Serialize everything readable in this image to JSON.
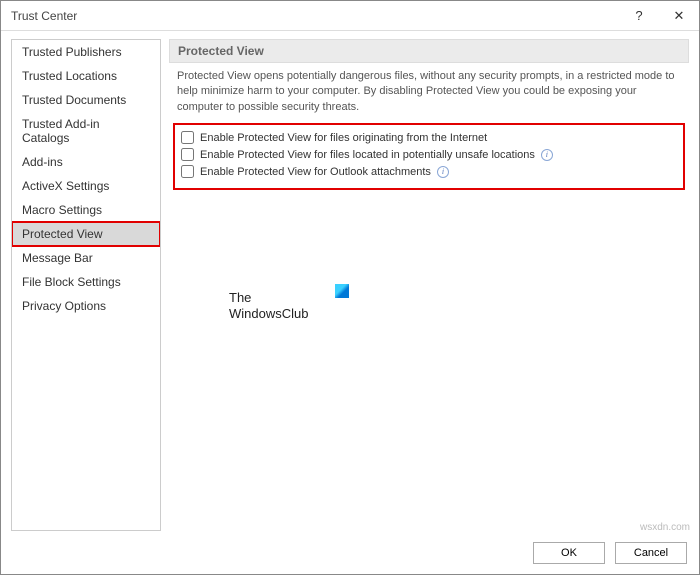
{
  "window": {
    "title": "Trust Center",
    "help_label": "?",
    "close_label": "✕"
  },
  "sidebar": {
    "items": [
      {
        "label": "Trusted Publishers"
      },
      {
        "label": "Trusted Locations"
      },
      {
        "label": "Trusted Documents"
      },
      {
        "label": "Trusted Add-in Catalogs"
      },
      {
        "label": "Add-ins"
      },
      {
        "label": "ActiveX Settings"
      },
      {
        "label": "Macro Settings"
      },
      {
        "label": "Protected View",
        "selected": true,
        "highlight": true
      },
      {
        "label": "Message Bar"
      },
      {
        "label": "File Block Settings"
      },
      {
        "label": "Privacy Options"
      }
    ]
  },
  "content": {
    "section_title": "Protected View",
    "description": "Protected View opens potentially dangerous files, without any security prompts, in a restricted mode to help minimize harm to your computer. By disabling Protected View you could be exposing your computer to possible security threats.",
    "checks": [
      {
        "label": "Enable Protected View for files originating from the Internet",
        "info": false
      },
      {
        "label": "Enable Protected View for files located in potentially unsafe locations",
        "info": true
      },
      {
        "label": "Enable Protected View for Outlook attachments",
        "info": true
      }
    ]
  },
  "logo": {
    "line1": "The",
    "line2": "WindowsClub"
  },
  "buttons": {
    "ok": "OK",
    "cancel": "Cancel"
  },
  "watermark": "wsxdn.com"
}
